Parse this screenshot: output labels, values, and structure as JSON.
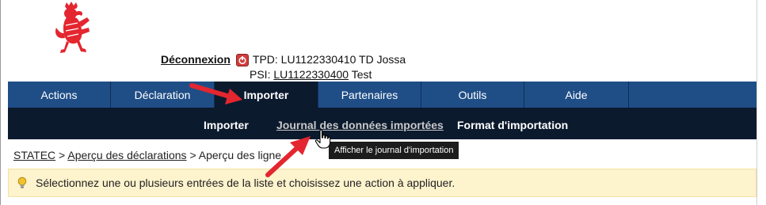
{
  "header": {
    "logout_label": "Déconnexion",
    "tpd_line": "TPD: LU1122330410 TD Jossa",
    "psi_prefix": "PSI:",
    "psi_code": "LU1122330400",
    "psi_name": "Test"
  },
  "nav": {
    "tabs": [
      {
        "label": "Actions"
      },
      {
        "label": "Déclaration"
      },
      {
        "label": "Importer"
      },
      {
        "label": "Partenaires"
      },
      {
        "label": "Outils"
      },
      {
        "label": "Aide"
      }
    ],
    "active_tab": "Importer"
  },
  "subnav": {
    "items": [
      {
        "label": "Importer"
      },
      {
        "label": "Journal des données importées"
      },
      {
        "label": "Format d'importation"
      }
    ],
    "hovered_item": "Journal des données importées"
  },
  "tooltip": {
    "text": "Afficher le journal d'importation"
  },
  "breadcrumb": {
    "items": [
      "STATEC",
      "Aperçu des déclarations",
      "Aperçu des ligne"
    ],
    "separator": ">"
  },
  "alert": {
    "text": "Sélectionnez une ou plusieurs entrées de la liste et choisissez une action à appliquer."
  },
  "icons": {
    "logo": "red-lion-crest-icon",
    "logout": "power-icon",
    "alert": "lightbulb-icon",
    "cursor": "hand-pointer-icon",
    "annotation": "red-arrow-icon"
  },
  "colors": {
    "nav_bg": "#1f4e87",
    "subnav_bg": "#0c1a2e",
    "alert_bg": "#fdf3cd",
    "brand_red": "#e3262f"
  }
}
